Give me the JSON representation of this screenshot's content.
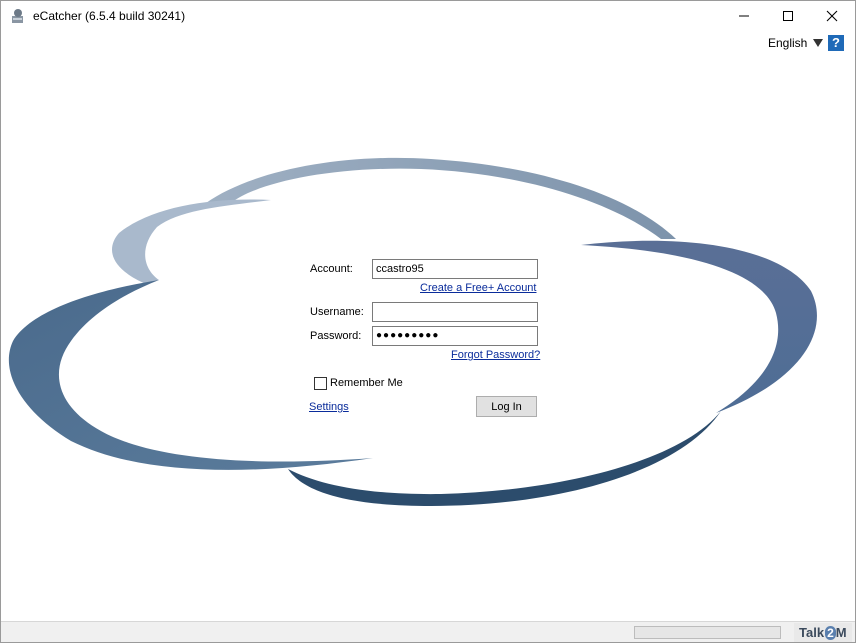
{
  "window": {
    "title": "eCatcher (6.5.4 build 30241)",
    "icon": "ecatcher-app-icon"
  },
  "header": {
    "language": "English",
    "help_label": "?"
  },
  "login": {
    "account_label": "Account:",
    "account_value": "ccastro95",
    "create_account_link": "Create a Free+ Account",
    "username_label": "Username:",
    "username_value": "",
    "password_label": "Password:",
    "password_value": "●●●●●●●●●",
    "forgot_password_link": "Forgot Password?",
    "remember_me_label": "Remember Me",
    "remember_me_checked": false,
    "settings_link": "Settings",
    "login_button": "Log In"
  },
  "statusbar": {
    "progress_fraction": 0,
    "brand_talk": "Talk",
    "brand_2": "2",
    "brand_m": "M"
  },
  "colors": {
    "cloud_dark": "#2e4e6e",
    "cloud_mid": "#5d7ea0",
    "cloud_light": "#a9b9cc",
    "link": "#0a2c9b"
  }
}
